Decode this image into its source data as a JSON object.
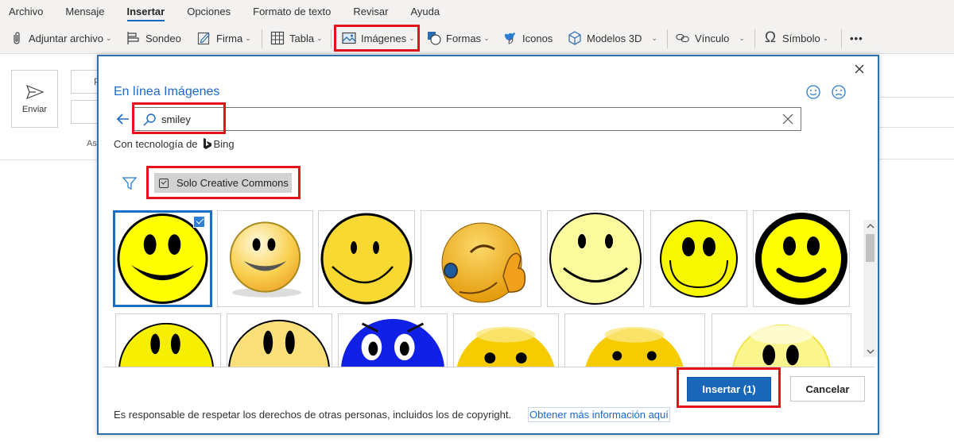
{
  "ribbon": {
    "tabs": [
      {
        "label": "Archivo",
        "active": false
      },
      {
        "label": "Mensaje",
        "active": false
      },
      {
        "label": "Insertar",
        "active": true
      },
      {
        "label": "Opciones",
        "active": false
      },
      {
        "label": "Formato de texto",
        "active": false
      },
      {
        "label": "Revisar",
        "active": false
      },
      {
        "label": "Ayuda",
        "active": false
      }
    ],
    "toolbar": {
      "attach": {
        "label": "Adjuntar archivo",
        "icon": "paperclip-icon",
        "has_dropdown": true
      },
      "poll": {
        "label": "Sondeo",
        "icon": "poll-icon",
        "has_dropdown": false
      },
      "signature": {
        "label": "Firma",
        "icon": "signature-icon",
        "has_dropdown": true
      },
      "table": {
        "label": "Tabla",
        "icon": "table-icon",
        "has_dropdown": true
      },
      "images": {
        "label": "Imágenes",
        "icon": "image-icon",
        "has_dropdown": true,
        "highlighted": true
      },
      "shapes": {
        "label": "Formas",
        "icon": "shapes-icon",
        "has_dropdown": true
      },
      "icons": {
        "label": "Iconos",
        "icon": "icons-icon",
        "has_dropdown": false
      },
      "models3d": {
        "label": "Modelos 3D",
        "icon": "cube-icon",
        "has_dropdown": true
      },
      "link": {
        "label": "Vínculo",
        "icon": "link-icon",
        "has_dropdown": true
      },
      "symbol": {
        "label": "Símbolo",
        "icon": "omega-icon",
        "has_dropdown": true
      },
      "more": {
        "label": "•••",
        "icon": "more-icon"
      }
    },
    "chevron": "⌄"
  },
  "compose": {
    "send_label": "Enviar",
    "field_1_label": "P",
    "subject_partial": "As"
  },
  "dialog": {
    "title": "En línea Imágenes",
    "search": {
      "value": "smiley",
      "placeholder": ""
    },
    "powered_by_prefix": "Con tecnología de",
    "powered_by_brand": "Bing",
    "filter": {
      "label": "Solo Creative Commons",
      "checked": true
    },
    "images": [
      {
        "desc": "Smiley amarillo clásico con borde negro",
        "selected": true
      },
      {
        "desc": "Smiley brillante dorado",
        "selected": false
      },
      {
        "desc": "Smiley amarillo con contorno grueso",
        "selected": false
      },
      {
        "desc": "Smiley guiñando el ojo con pulgar arriba",
        "selected": false
      },
      {
        "desc": "Smiley amarillo claro",
        "selected": false
      },
      {
        "desc": "Smiley amarillo con borde fino",
        "selected": false
      },
      {
        "desc": "Smiley con borde negro grueso",
        "selected": false
      },
      {
        "desc": "Smiley amarillo",
        "selected": false
      },
      {
        "desc": "Smiley amarillo pálido",
        "selected": false
      },
      {
        "desc": "Smiley azul enfadado",
        "selected": false
      },
      {
        "desc": "Smiley amarillo brillante",
        "selected": false
      },
      {
        "desc": "Smiley amarillo brillante 2",
        "selected": false
      },
      {
        "desc": "Smiley amarillo claro brillante",
        "selected": false
      }
    ],
    "insert_button": "Insertar (1)",
    "cancel_button": "Cancelar",
    "footer_text": "Es responsable de respetar los derechos de otras personas, incluidos los de copyright.",
    "footer_link": "Obtener más información aquí"
  },
  "colors": {
    "accent": "#1a66b8",
    "highlight": "#e3121b",
    "link": "#1b6ac9"
  }
}
